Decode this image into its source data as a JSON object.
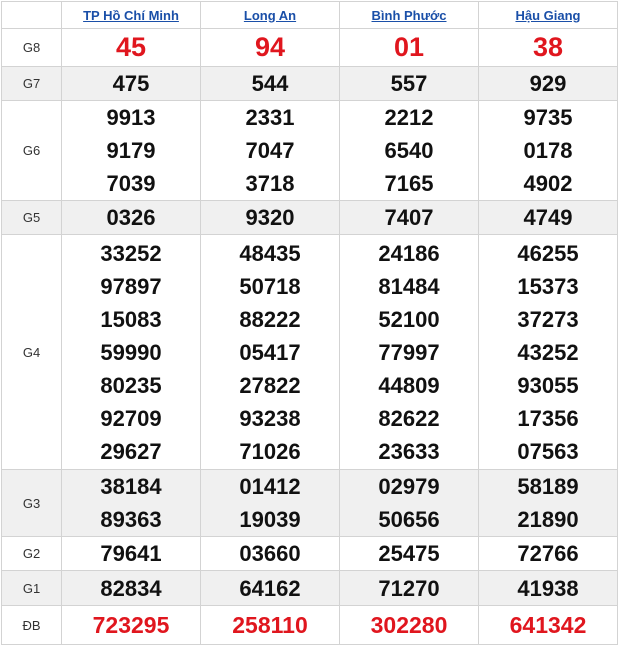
{
  "provinces": [
    "TP Hồ Chí Minh",
    "Long An",
    "Bình Phước",
    "Hậu Giang"
  ],
  "prizes": [
    {
      "label": "G8",
      "numbers": [
        [
          "45"
        ],
        [
          "94"
        ],
        [
          "01"
        ],
        [
          "38"
        ]
      ]
    },
    {
      "label": "G7",
      "numbers": [
        [
          "475"
        ],
        [
          "544"
        ],
        [
          "557"
        ],
        [
          "929"
        ]
      ]
    },
    {
      "label": "G6",
      "numbers": [
        [
          "9913",
          "9179",
          "7039"
        ],
        [
          "2331",
          "7047",
          "3718"
        ],
        [
          "2212",
          "6540",
          "7165"
        ],
        [
          "9735",
          "0178",
          "4902"
        ]
      ]
    },
    {
      "label": "G5",
      "numbers": [
        [
          "0326"
        ],
        [
          "9320"
        ],
        [
          "7407"
        ],
        [
          "4749"
        ]
      ]
    },
    {
      "label": "G4",
      "numbers": [
        [
          "33252",
          "97897",
          "15083",
          "59990",
          "80235",
          "92709",
          "29627"
        ],
        [
          "48435",
          "50718",
          "88222",
          "05417",
          "27822",
          "93238",
          "71026"
        ],
        [
          "24186",
          "81484",
          "52100",
          "77997",
          "44809",
          "82622",
          "23633"
        ],
        [
          "46255",
          "15373",
          "37273",
          "43252",
          "93055",
          "17356",
          "07563"
        ]
      ]
    },
    {
      "label": "G3",
      "numbers": [
        [
          "38184",
          "89363"
        ],
        [
          "01412",
          "19039"
        ],
        [
          "02979",
          "50656"
        ],
        [
          "58189",
          "21890"
        ]
      ]
    },
    {
      "label": "G2",
      "numbers": [
        [
          "79641"
        ],
        [
          "03660"
        ],
        [
          "25475"
        ],
        [
          "72766"
        ]
      ]
    },
    {
      "label": "G1",
      "numbers": [
        [
          "82834"
        ],
        [
          "64162"
        ],
        [
          "71270"
        ],
        [
          "41938"
        ]
      ]
    },
    {
      "label": "ĐB",
      "numbers": [
        [
          "723295"
        ],
        [
          "258110"
        ],
        [
          "302280"
        ],
        [
          "641342"
        ]
      ]
    }
  ],
  "colors": {
    "header_link": "#1a4fa8",
    "highlight": "#e0161e",
    "alt_row": "#f0f0f0",
    "border": "#d3d3d3"
  }
}
